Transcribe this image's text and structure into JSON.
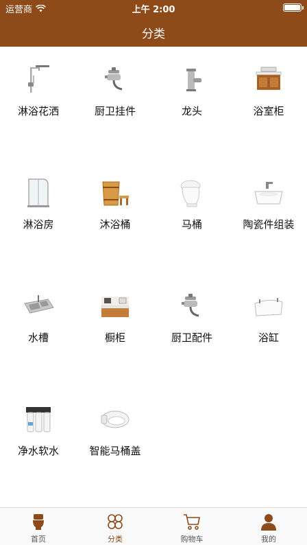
{
  "status_bar": {
    "carrier": "运营商",
    "time": "上午 2:00"
  },
  "nav": {
    "title": "分类"
  },
  "categories": [
    {
      "label": "淋浴花洒",
      "icon": "shower-icon"
    },
    {
      "label": "厨卫挂件",
      "icon": "kitchen-bath-fixture-icon"
    },
    {
      "label": "龙头",
      "icon": "faucet-icon"
    },
    {
      "label": "浴室柜",
      "icon": "bathroom-cabinet-icon"
    },
    {
      "label": "淋浴房",
      "icon": "shower-room-icon"
    },
    {
      "label": "沐浴桶",
      "icon": "bath-barrel-icon"
    },
    {
      "label": "马桶",
      "icon": "toilet-icon"
    },
    {
      "label": "陶瓷件组装",
      "icon": "ceramic-basin-icon"
    },
    {
      "label": "水槽",
      "icon": "sink-icon"
    },
    {
      "label": "橱柜",
      "icon": "kitchen-cabinet-icon"
    },
    {
      "label": "厨卫配件",
      "icon": "kitchen-bath-accessory-icon"
    },
    {
      "label": "浴缸",
      "icon": "bathtub-icon"
    },
    {
      "label": "净水软水",
      "icon": "water-purifier-icon"
    },
    {
      "label": "智能马桶盖",
      "icon": "smart-toilet-seat-icon"
    }
  ],
  "tabs": [
    {
      "label": "首页",
      "icon": "home-toilet-icon"
    },
    {
      "label": "分类",
      "icon": "category-icon",
      "active": true
    },
    {
      "label": "购物车",
      "icon": "cart-icon"
    },
    {
      "label": "我的",
      "icon": "profile-icon"
    }
  ],
  "colors": {
    "brand": "#8e4a19",
    "tab_inactive": "#555555"
  }
}
